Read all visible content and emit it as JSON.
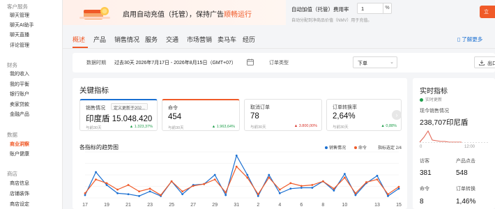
{
  "sidebar": {
    "groups": [
      {
        "label": "客户服务",
        "items": [
          "聊天管理",
          "聊天AI助手",
          "聊天直播",
          "评论管理"
        ]
      },
      {
        "label": "财务",
        "items": [
          "我的收入",
          "我的平衡",
          "银行账户",
          "卖家贷款",
          "金融产品"
        ]
      },
      {
        "label": "数据",
        "items": [
          "商业洞察",
          "账户健康"
        ]
      },
      {
        "label": "商店",
        "items": [
          "商店信息",
          "店铺装饰",
          "商店设定"
        ]
      }
    ],
    "active_item": "商业洞察"
  },
  "banner": {
    "text_before": "启用自动充值（托管），保持广告",
    "text_highlight": "顺畅运行",
    "rate_label": "自动加值（托管）费用率",
    "rate_value": "1",
    "rate_unit": "%",
    "rate_hint": "自动分配到净商品价值（NMV）用于充值。",
    "button_label": "立"
  },
  "tabs": {
    "items": [
      "概述",
      "产品",
      "销售情况",
      "服务",
      "交通",
      "市场营销",
      "卖马车",
      "经历"
    ],
    "active": "概述",
    "learn_more": "了解更多"
  },
  "filter": {
    "period_label": "数据时期",
    "period_value": "过去30天  2026年7月17日 - 2026年8月15日（GMT+07）",
    "order_type_label": "订单类型",
    "order_type_value": "下单",
    "export_label": "出口"
  },
  "key_metrics": {
    "title": "关键指标",
    "cards": [
      {
        "label": "销售情况",
        "dropdown": "定义更新于202...",
        "value": "印度盾 15.048.420",
        "prev": "与前30天",
        "delta": "1.323,37%",
        "dir": "up"
      },
      {
        "label": "命令",
        "value": "454",
        "prev": "与前30天",
        "delta": "1.963,64%",
        "dir": "up"
      },
      {
        "label": "取消订单",
        "value": "78",
        "prev": "与前30天",
        "delta": "3.800,00%",
        "dir": "down"
      },
      {
        "label": "订单转换率",
        "value": "2,64%",
        "prev": "与前30天",
        "delta": "0,88%",
        "dir": "up"
      }
    ],
    "trend_title": "各指标的趋势图",
    "legend": [
      {
        "name": "销售情况",
        "color": "#1a6fd1"
      },
      {
        "name": "命令",
        "color": "#f05a28"
      }
    ],
    "indicator_label": "指标选定 2/4"
  },
  "chart_data": {
    "type": "line",
    "x": [
      "17",
      "18",
      "19",
      "20",
      "21",
      "22",
      "23",
      "24",
      "25",
      "26",
      "27",
      "28",
      "29",
      "30",
      "31",
      "1",
      "2",
      "3",
      "4",
      "5",
      "6",
      "7",
      "8",
      "9",
      "10",
      "11",
      "12",
      "13",
      "14",
      "15"
    ],
    "x_tick_labels": [
      "17",
      "19",
      "21",
      "23",
      "25",
      "27",
      "29",
      "31",
      "2",
      "4",
      "6",
      "8",
      "10",
      "13",
      "15"
    ],
    "series": [
      {
        "name": "销售情况",
        "color": "#1a6fd1",
        "values": [
          3,
          28,
          14,
          5,
          4,
          2,
          7,
          2,
          18,
          4,
          14,
          15,
          25,
          3,
          46,
          25,
          2,
          25,
          5,
          10,
          11,
          11,
          18,
          8,
          26,
          3,
          16,
          24,
          2,
          10
        ]
      },
      {
        "name": "命令",
        "color": "#f05a28",
        "values": [
          5,
          20,
          16,
          9,
          14,
          7,
          10,
          3,
          18,
          7,
          13,
          15,
          20,
          6,
          34,
          22,
          4,
          22,
          9,
          16,
          13,
          14,
          18,
          10,
          22,
          5,
          17,
          20,
          4,
          12
        ]
      }
    ],
    "ylim": [
      0,
      50
    ]
  },
  "realtime": {
    "title": "实时指标",
    "subtitle": "实时更新",
    "sales_label": "现今销售情况",
    "sales_value": "238,707印尼盾",
    "tick_left": "0",
    "tick_right": "12:00",
    "sparkline": [
      0,
      7,
      16,
      3,
      2,
      1,
      1,
      0,
      0,
      0,
      0
    ],
    "visitors_label": "访客",
    "visitors_value": "381",
    "products_label": "产品点击",
    "products_value": "548",
    "orders_label": "命令",
    "orders_value": "8",
    "conv_label": "订单转换",
    "conv_value": "1,46%"
  }
}
